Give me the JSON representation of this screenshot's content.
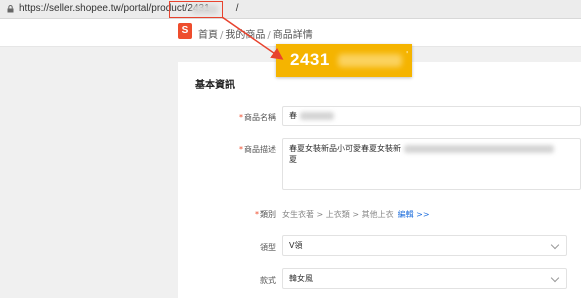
{
  "browser": {
    "url_text": "https://seller.shopee.tw/portal/product/2431",
    "url_suffix": "/"
  },
  "header": {
    "logo_glyph": "S",
    "breadcrumb": [
      "首頁",
      "我的商品",
      "商品詳情"
    ],
    "breadcrumb_sep": "/"
  },
  "callout": {
    "id_prefix": "2431",
    "mark": "'"
  },
  "form": {
    "section_title": "基本資訊",
    "required_mark": "*",
    "name": {
      "label": "商品名稱",
      "value_prefix": "春"
    },
    "description": {
      "label": "商品描述",
      "line1": "春夏女裝新品小可愛春夏女裝新",
      "line2": "夏"
    },
    "category": {
      "label": "類別",
      "path": "女生衣著 > 上衣類 > 其他上衣",
      "edit_link": "編輯 >>"
    },
    "collar": {
      "label": "領型",
      "value": "V領"
    },
    "style": {
      "label": "款式",
      "value": "韓女風"
    }
  },
  "colors": {
    "accent": "#ee4d2d",
    "callout_bg": "#f5b400",
    "link": "#2673dd",
    "annotation_red": "#e8432e"
  }
}
